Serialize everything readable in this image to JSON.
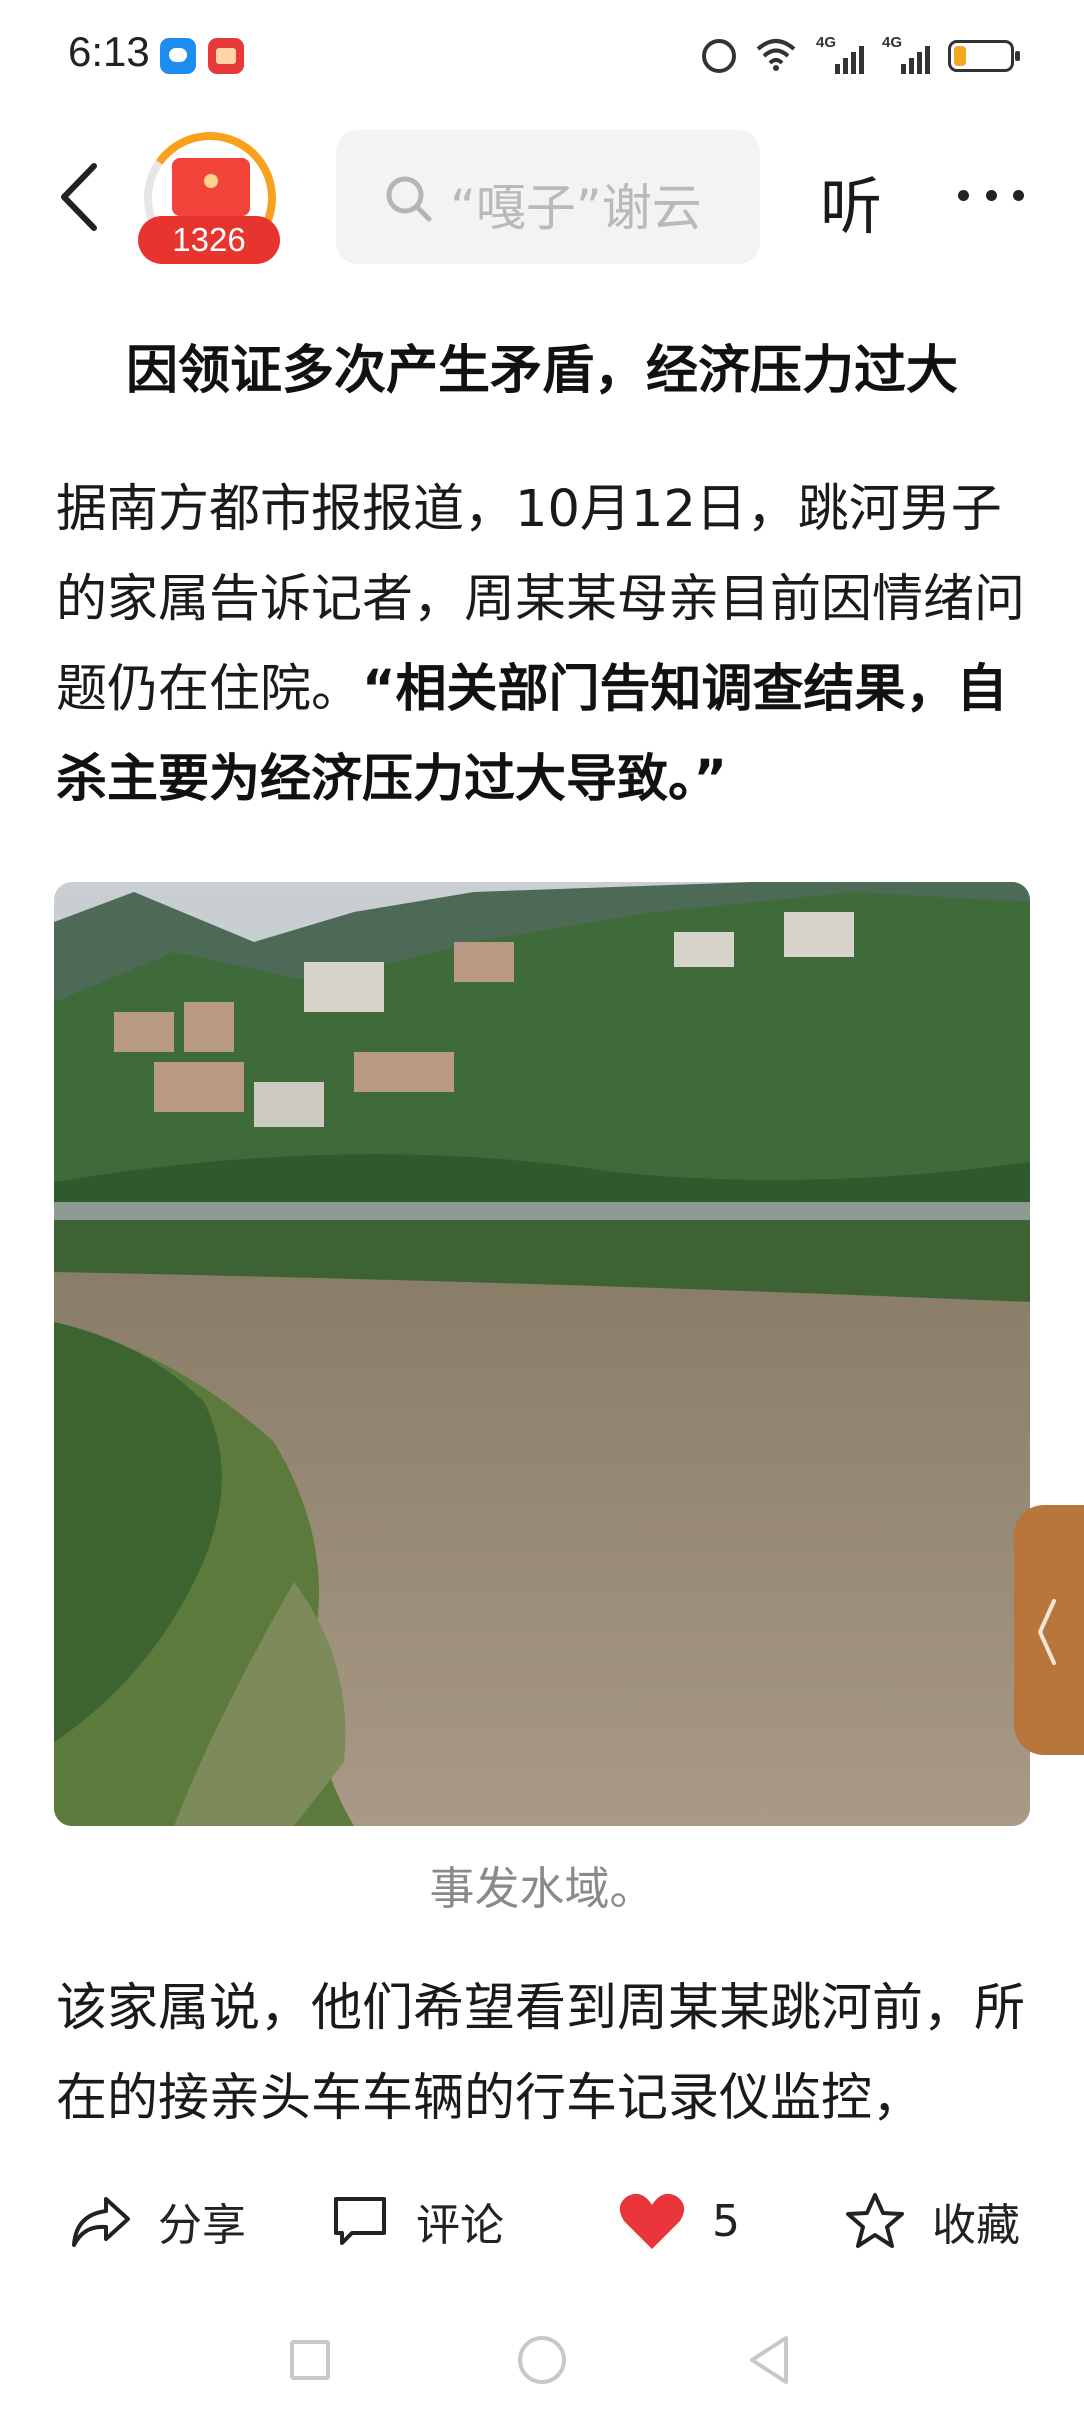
{
  "status_bar": {
    "time": "6:13",
    "signal_labels": [
      "4G",
      "4G"
    ],
    "battery_percent": 15
  },
  "header": {
    "red_packet_count": "1326",
    "search_placeholder": "“嘎子”谢云",
    "listen_label": "听"
  },
  "article": {
    "subtitle": "因领证多次产生矛盾，经济压力过大",
    "paragraph1_plain": "据南方都市报报道，10月12日，跳河男子的家属告诉记者，周某某母亲目前因情绪问题仍在住院。",
    "paragraph1_bold": "“相关部门告知调查结果，自杀主要为经济压力过大导致。”",
    "photo_caption": "事发水域。",
    "paragraph2": "该家属说，他们希望看到周某某跳河前，所在的接亲头车车辆的行车记录仪监控，"
  },
  "actions": {
    "share_label": "分享",
    "comment_label": "评论",
    "like_count": "5",
    "favorite_label": "收藏"
  },
  "colors": {
    "accent_red": "#e8342e",
    "progress_orange": "#f7a11c",
    "side_tab": "#b9763a"
  }
}
